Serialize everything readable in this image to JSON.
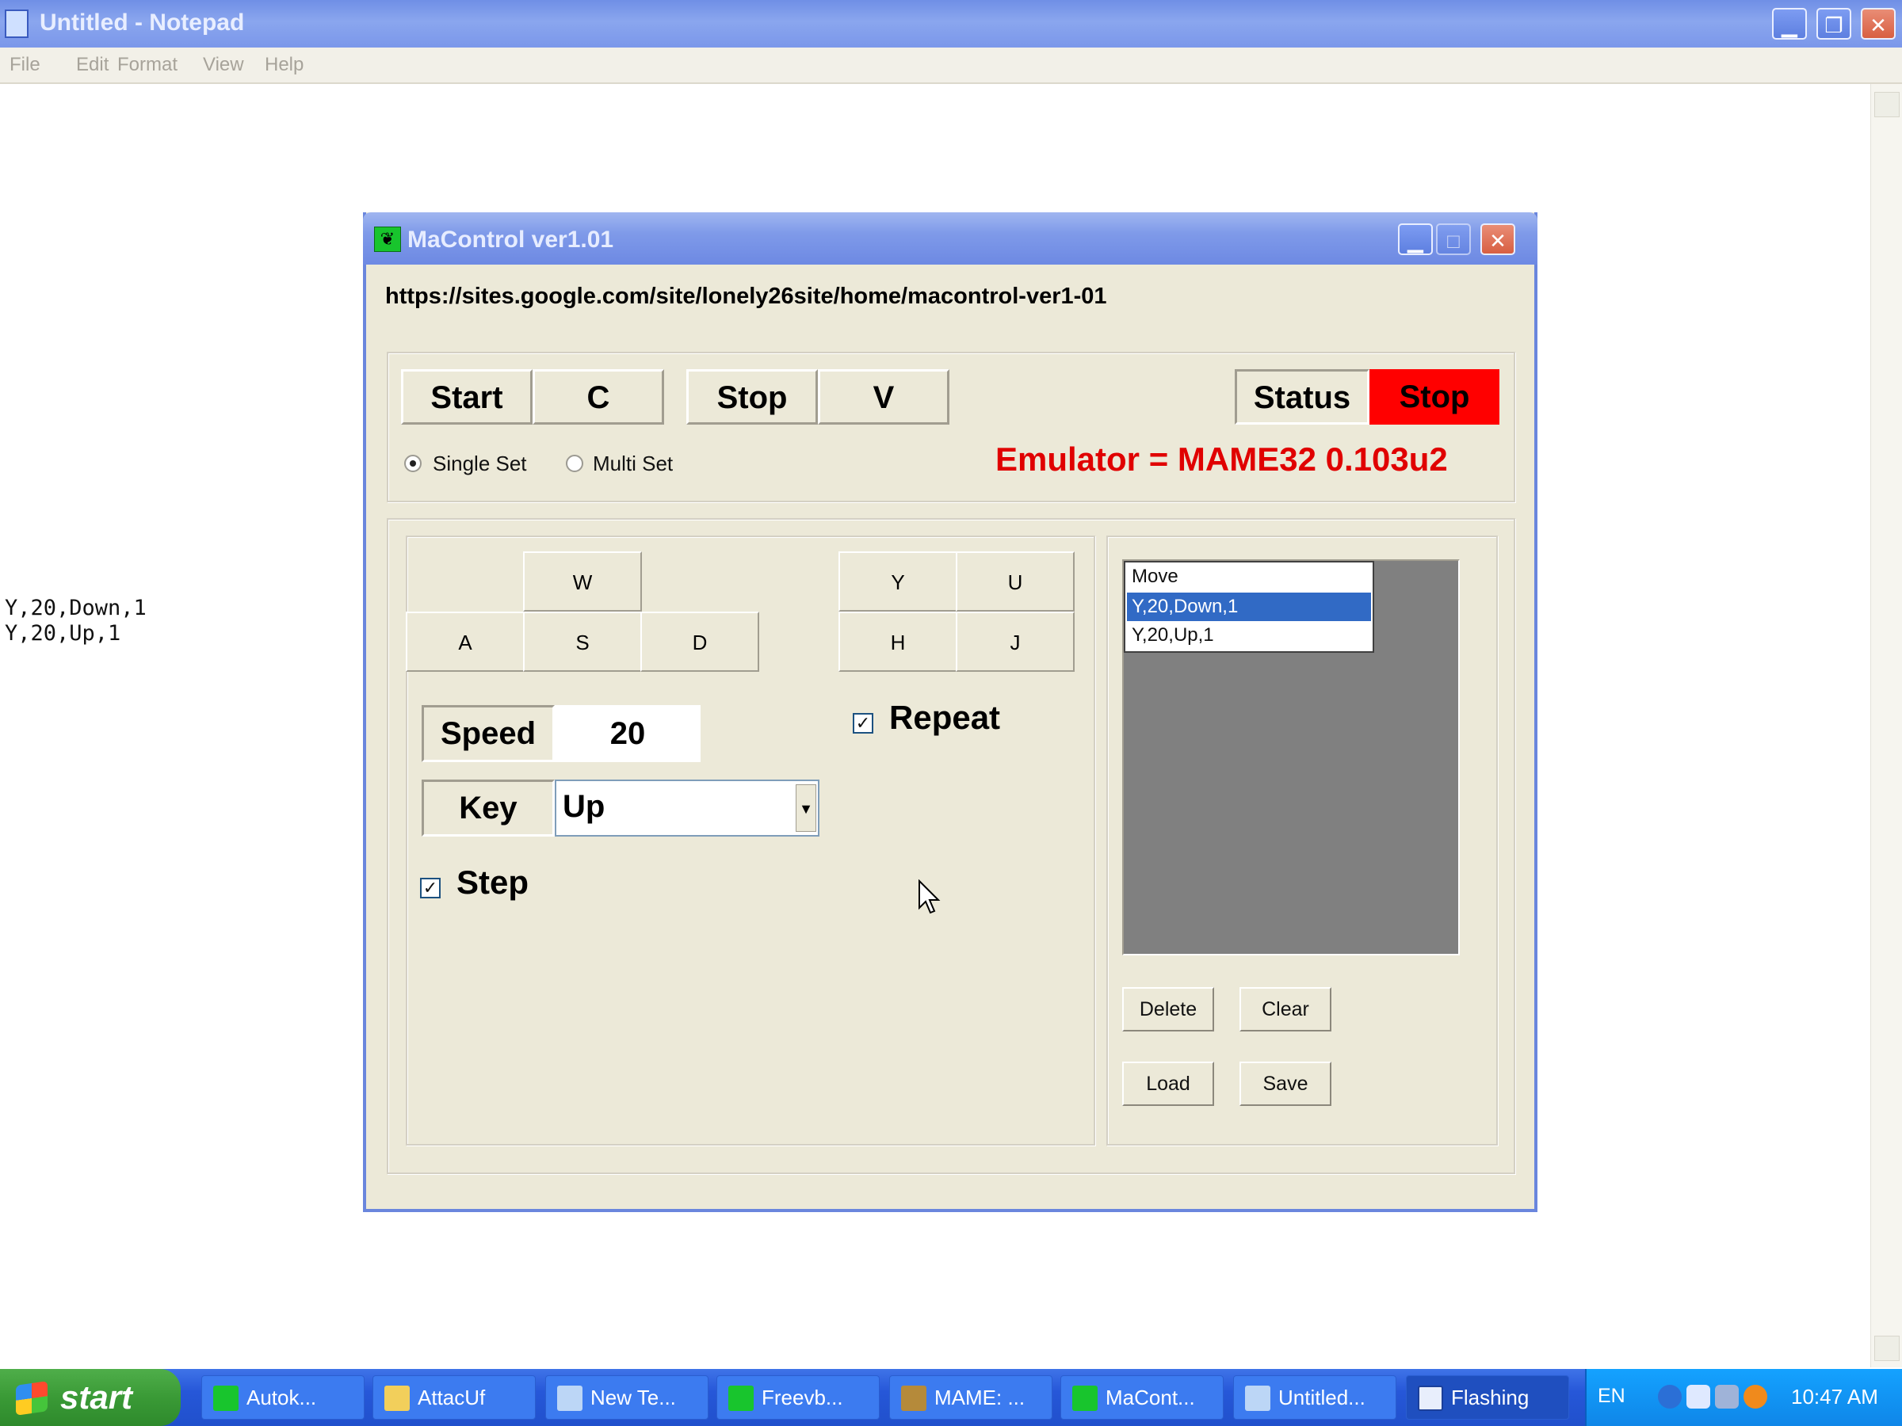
{
  "notepad": {
    "title": "Untitled - Notepad",
    "menu": [
      "File",
      "Edit",
      "Format",
      "View",
      "Help"
    ],
    "content": "Y,20,Down,1\nY,20,Up,1",
    "window_buttons": [
      "minimize-icon",
      "restore-icon",
      "close-icon"
    ]
  },
  "dialog": {
    "title": "MaControl ver1.01",
    "url": "https://sites.google.com/site/lonely26site/home/macontrol-ver1-01",
    "controls": {
      "start": "Start",
      "start_key": "C",
      "stop": "Stop",
      "stop_key": "V",
      "status_label": "Status",
      "status_value": "Stop",
      "status_color": "#ff0000"
    },
    "mode": {
      "single": "Single Set",
      "multi": "Multi Set",
      "selected": "Single Set"
    },
    "emulator": "Emulator = MAME32 0.103u2",
    "keys_left": {
      "w": "W",
      "a": "A",
      "s": "S",
      "d": "D"
    },
    "keys_right": {
      "y": "Y",
      "u": "U",
      "h": "H",
      "j": "J"
    },
    "speed": {
      "label": "Speed",
      "value": "20"
    },
    "key": {
      "label": "Key",
      "value": "Up"
    },
    "repeat": {
      "label": "Repeat",
      "checked": true
    },
    "step": {
      "label": "Step",
      "checked": true
    },
    "list": {
      "header": "Move",
      "items": [
        "Y,20,Down,1",
        "Y,20,Up,1"
      ],
      "selected_index": 0
    },
    "buttons": {
      "delete": "Delete",
      "clear": "Clear",
      "load": "Load",
      "save": "Save"
    }
  },
  "taskbar": {
    "start": "start",
    "tasks": [
      {
        "label": "Autok...",
        "icon": "green-app-icon"
      },
      {
        "label": "AttacUf",
        "icon": "folder-icon"
      },
      {
        "label": "New Te...",
        "icon": "notepad-icon"
      },
      {
        "label": "Freevb...",
        "icon": "green-app-icon"
      },
      {
        "label": "MAME: ...",
        "icon": "mame-icon"
      },
      {
        "label": "MaCont...",
        "icon": "green-app-icon"
      },
      {
        "label": "Untitled...",
        "icon": "notepad-icon"
      },
      {
        "label": "Flashing",
        "icon": "window-icon"
      }
    ],
    "tray": {
      "lang": "EN",
      "time": "10:47 AM"
    }
  },
  "colors": {
    "accent_red": "#e00000",
    "selection": "#316ac5",
    "taskbar": "#2657d8"
  }
}
